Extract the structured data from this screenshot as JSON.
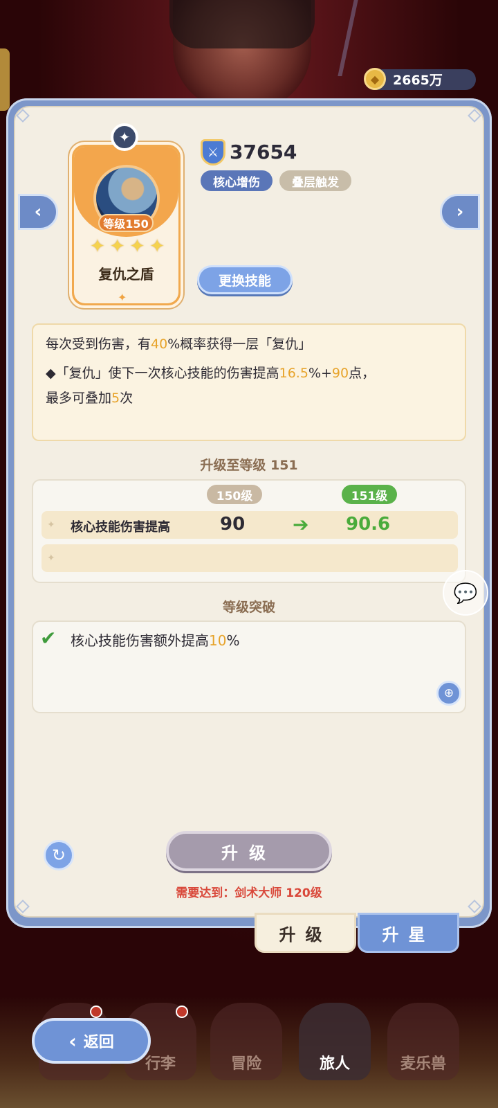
{
  "currency": {
    "amount": "2665万",
    "icon": "gold-coin-icon"
  },
  "skill": {
    "level_badge": "等级150",
    "name": "复仇之盾",
    "stars": 4,
    "power": "37654",
    "tags": [
      "核心增伤",
      "叠层触发"
    ],
    "swap_button": "更换技能"
  },
  "description": {
    "line1": {
      "a": "每次受到伤害，有",
      "hl1": "40",
      "b": "%概率获得一层「复仇」"
    },
    "line2": {
      "a": "◆「复仇」使下一次核心技能的伤害提高",
      "hl1": "16.5",
      "b": "%+",
      "hl2": "90",
      "c": "点，"
    },
    "line3": {
      "a": "最多可叠加",
      "hl1": "5",
      "b": "次"
    }
  },
  "upgrade_section": {
    "title": "升级至等级 151",
    "current_level": "150级",
    "next_level": "151级",
    "rows": [
      {
        "label": "核心技能伤害提高",
        "old": "90",
        "new": "90.6"
      }
    ]
  },
  "breakthrough": {
    "title": "等级突破",
    "text_a": "核心技能伤害额外提高",
    "text_hl": "10",
    "text_b": "%"
  },
  "actions": {
    "upgrade_button": "升级",
    "requirement": "需要达到：剑术大师 120级"
  },
  "tabs": {
    "upgrade": "升级",
    "star_up": "升星"
  },
  "bottom_nav": {
    "back": "返回",
    "items": [
      "行李",
      "冒险",
      "旅人",
      "麦乐兽"
    ]
  },
  "colors": {
    "accent_blue": "#6f93d6",
    "highlight": "#e7a32a",
    "green": "#4aab3b",
    "requirement_red": "#d9483a"
  }
}
